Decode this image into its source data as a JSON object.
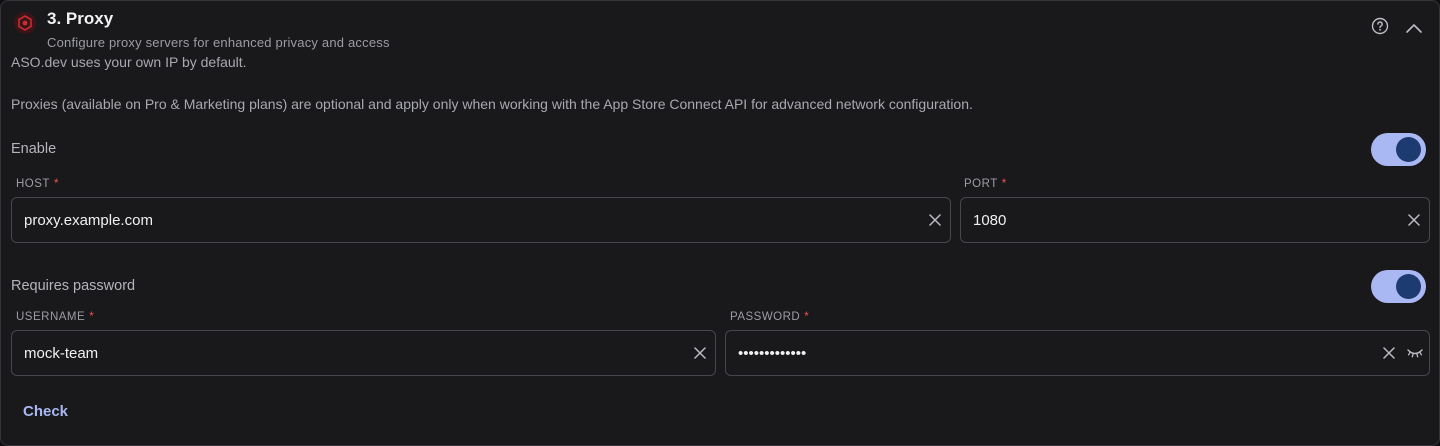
{
  "section": {
    "title": "3. Proxy",
    "subtitle": "Configure proxy servers for enhanced privacy and access",
    "icon": "proxy-icon",
    "help_icon": "help-circle-icon",
    "collapse_icon": "chevron-up-icon"
  },
  "description": {
    "line1": "ASO.dev uses your own IP by default.",
    "line2": "Proxies (available on Pro & Marketing plans) are optional and apply only when working with the App Store Connect API for advanced network configuration."
  },
  "enable": {
    "label": "Enable",
    "on": true
  },
  "host": {
    "label": "HOST",
    "required": "*",
    "value": "proxy.example.com"
  },
  "port": {
    "label": "PORT",
    "required": "*",
    "value": "1080"
  },
  "requires_password": {
    "label": "Requires password",
    "on": true
  },
  "username": {
    "label": "USERNAME",
    "required": "*",
    "value": "mock-team"
  },
  "password": {
    "label": "PASSWORD",
    "required": "*",
    "value": "•••••••••••••"
  },
  "check_button": {
    "label": "Check"
  },
  "colors": {
    "accent": "#a9b8f2",
    "knob": "#1d3b6e",
    "required": "#ef5350",
    "brand_icon": "#b3262b"
  }
}
